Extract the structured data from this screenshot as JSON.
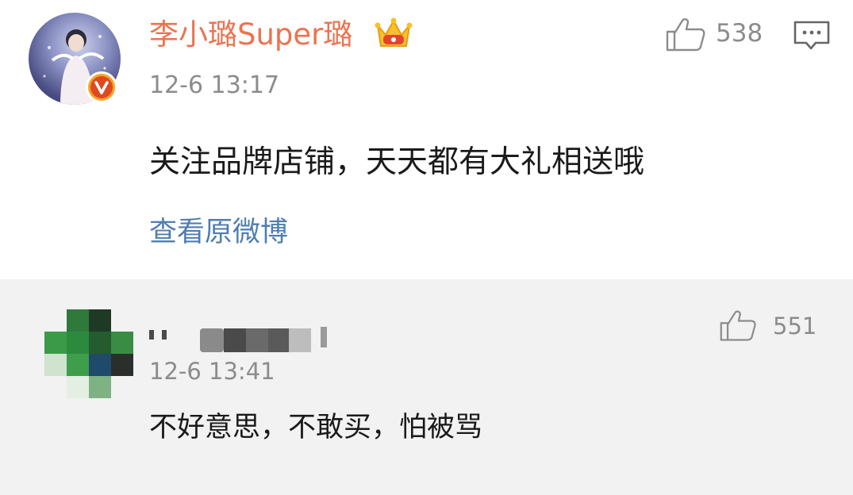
{
  "comments": [
    {
      "author": "李小璐Super璐",
      "author_color": "#eb7350",
      "time": "12-6 13:17",
      "text": "关注品牌店铺，天天都有大礼相送哦",
      "link": "查看原微博",
      "link_color": "#507daf",
      "likes": "538",
      "icons": [
        "verified-badge-icon",
        "crown-icon",
        "thumbs-up-icon",
        "reply-icon"
      ]
    },
    {
      "author": "",
      "author_blurred": true,
      "time": "12-6 13:41",
      "text": "不好意思，不敢买，怕被骂",
      "likes": "551",
      "icons": [
        "thumbs-up-icon"
      ]
    }
  ],
  "colors": {
    "background": "#ffffff",
    "reply_background": "#f2f2f2",
    "muted_text": "#8c8c8c",
    "body_text": "#1a1a1a"
  }
}
